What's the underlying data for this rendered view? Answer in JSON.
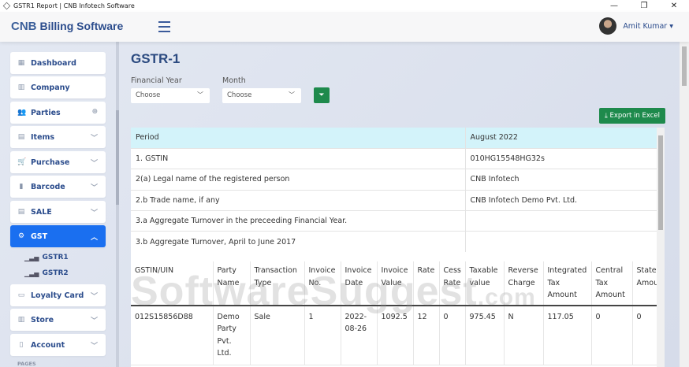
{
  "window": {
    "title": "GSTR1 Report | CNB Infotech Software",
    "min": "—",
    "max": "❐",
    "close": "✕"
  },
  "header": {
    "brand_short": "CNB",
    "brand_name": "Billing Software",
    "user": "Amit Kumar ▾"
  },
  "sidebar": {
    "items": [
      {
        "label": "Dashboard",
        "icon": "▦"
      },
      {
        "label": "Company",
        "icon": "▥"
      },
      {
        "label": "Parties",
        "icon": "👥",
        "extra": "⊕"
      },
      {
        "label": "Items",
        "icon": "▤",
        "chev": "﹀"
      },
      {
        "label": "Purchase",
        "icon": "🛒",
        "chev": "﹀"
      },
      {
        "label": "Barcode",
        "icon": "▮",
        "chev": "﹀"
      },
      {
        "label": "SALE",
        "icon": "▤",
        "chev": "﹀"
      },
      {
        "label": "GST",
        "icon": "⚙",
        "chev": "︿"
      },
      {
        "label": "Loyalty Card",
        "icon": "▭",
        "chev": "﹀"
      },
      {
        "label": "Store",
        "icon": "▥",
        "chev": "﹀"
      },
      {
        "label": "Account",
        "icon": "▯",
        "chev": "﹀"
      }
    ],
    "sub": [
      {
        "label": "GSTR1"
      },
      {
        "label": "GSTR2"
      }
    ],
    "section": "PAGES"
  },
  "page": {
    "title": "GSTR-1",
    "fy_label": "Financial Year",
    "fy_value": "Choose",
    "month_label": "Month",
    "month_value": "Choose",
    "filter": "⏷",
    "export": "⤓ Export in Excel"
  },
  "info": [
    [
      "Period",
      "August 2022"
    ],
    [
      "1. GSTIN",
      "010HG15548HG32s"
    ],
    [
      "2(a) Legal name of the registered person",
      "CNB Infotech"
    ],
    [
      "2.b Trade name, if any",
      "CNB Infotech Demo Pvt. Ltd."
    ],
    [
      "3.a Aggregate Turnover in the preceeding Financial Year.",
      ""
    ],
    [
      "3.b Aggregate Turnover, April to June 2017",
      ""
    ]
  ],
  "table": {
    "headers": [
      "GSTIN/UIN",
      "Party Name",
      "Transaction Type",
      "Invoice No.",
      "Invoice Date",
      "Invoice Value",
      "Rate",
      "Cess Rate",
      "Taxable value",
      "Reverse Charge",
      "Integrated Tax Amount",
      "Central Tax Amount",
      "State Tax Amount"
    ],
    "rows": [
      [
        "012S15856D88",
        "Demo Party Pvt. Ltd.",
        "Sale",
        "1",
        "2022-08-26",
        "1092.5",
        "12",
        "0",
        "975.45",
        "N",
        "117.05",
        "0",
        "0"
      ]
    ]
  },
  "watermark": {
    "main": "SoftwareSuggest",
    "suffix": ".com"
  }
}
